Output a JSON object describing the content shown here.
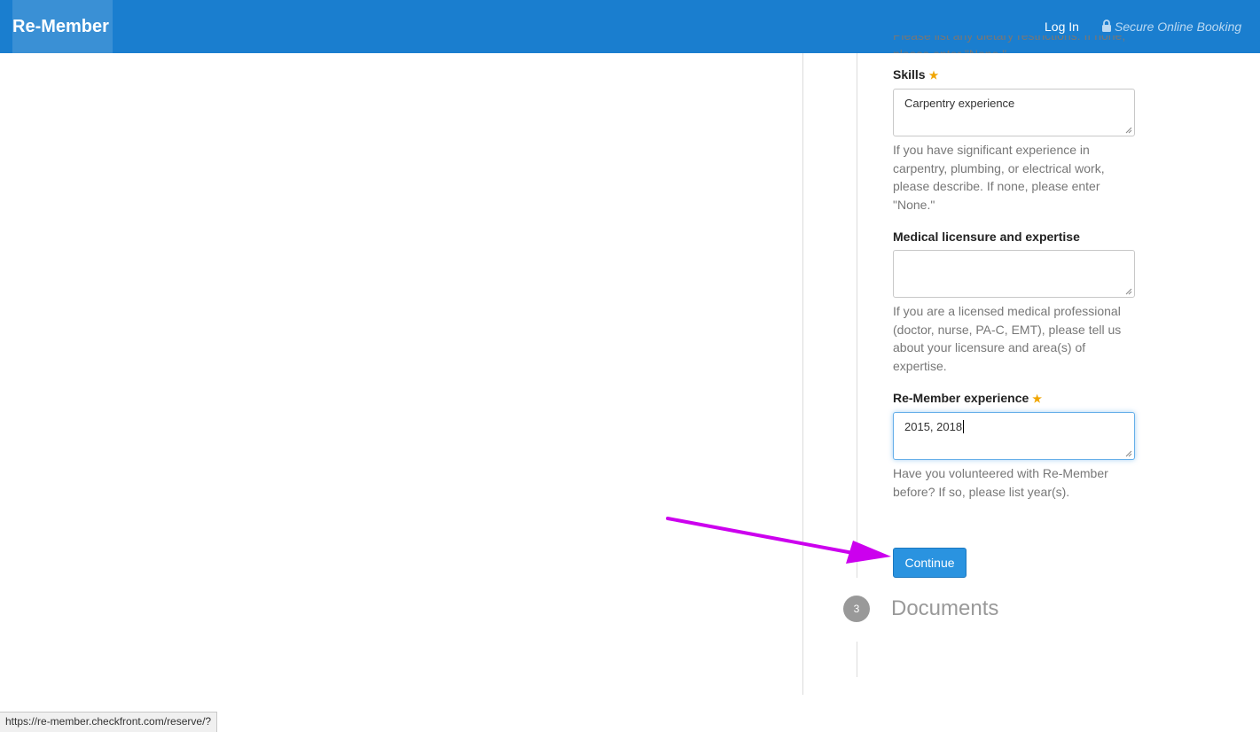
{
  "header": {
    "brand": "Re-Member",
    "login": "Log In",
    "secure": "Secure Online Booking"
  },
  "form": {
    "dietary_help_tail": "Please list any dietary restrictions. If none, please enter \"None.\"",
    "skills": {
      "label": "Skills",
      "value": "Carpentry experience",
      "help": "If you have significant experience in carpentry, plumbing, or electrical work, please describe. If none, please enter \"None.\""
    },
    "medical": {
      "label": "Medical licensure and expertise",
      "value": "",
      "help": "If you are a licensed medical professional (doctor, nurse, PA-C, EMT), please tell us about your licensure and area(s) of expertise."
    },
    "experience": {
      "label": "Re-Member experience",
      "value": "2015, 2018",
      "help": "Have you volunteered with Re-Member before? If so, please list year(s)."
    },
    "continue_label": "Continue"
  },
  "steps": {
    "next_number": "3",
    "next_title": "Documents"
  },
  "status_bar": {
    "url": "https://re-member.checkfront.com/reserve/?"
  },
  "colors": {
    "header_bg": "#1a7ecf",
    "button_bg": "#2a93e0",
    "required_star": "#f0a500",
    "annotation_arrow": "#cc00ee"
  },
  "icons": {
    "lock": "lock-icon",
    "required": "star-icon",
    "annotation": "arrow-annotation"
  }
}
